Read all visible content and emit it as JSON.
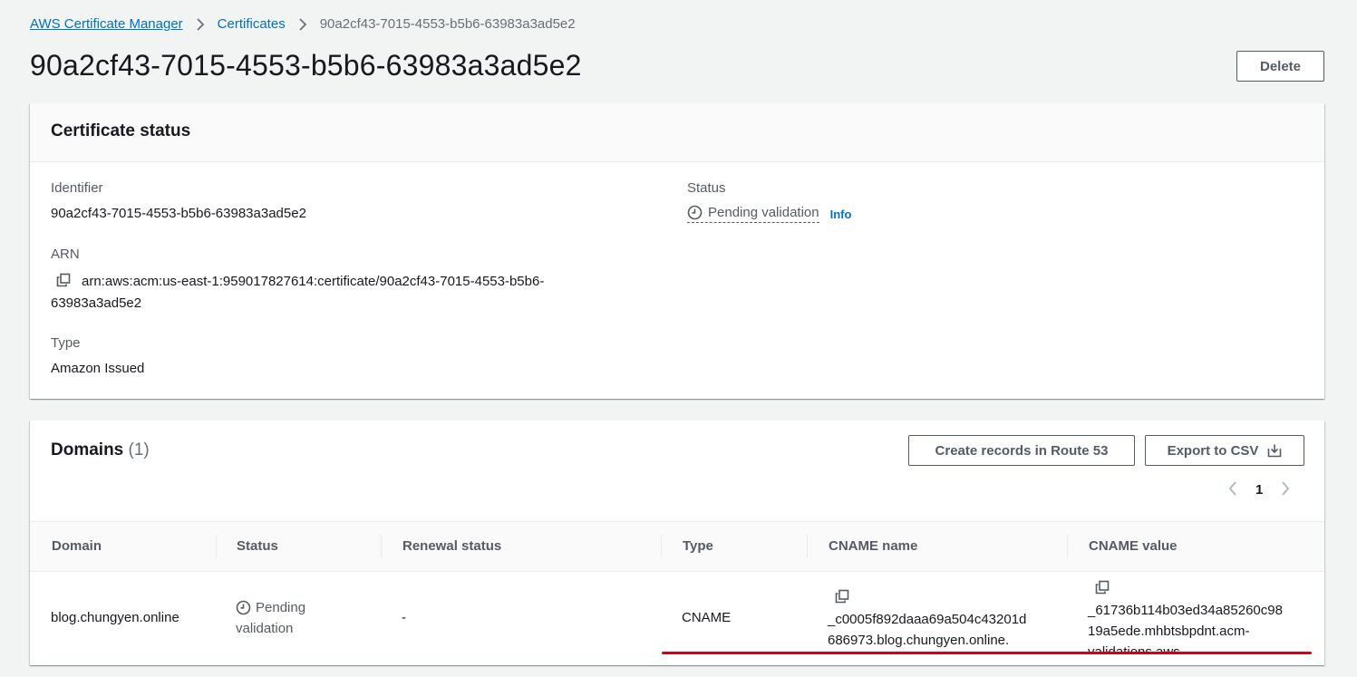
{
  "breadcrumb": {
    "root": "AWS Certificate Manager",
    "certificates": "Certificates",
    "current": "90a2cf43-7015-4553-b5b6-63983a3ad5e2"
  },
  "page_title": "90a2cf43-7015-4553-b5b6-63983a3ad5e2",
  "delete_label": "Delete",
  "certificate_status": {
    "title": "Certificate status",
    "identifier_label": "Identifier",
    "identifier_value": "90a2cf43-7015-4553-b5b6-63983a3ad5e2",
    "status_label": "Status",
    "status_value": "Pending validation",
    "info_label": "Info",
    "arn_label": "ARN",
    "arn_value": "arn:aws:acm:us-east-1:959017827614:certificate/90a2cf43-7015-4553-b5b6-63983a3ad5e2",
    "type_label": "Type",
    "type_value": "Amazon Issued"
  },
  "domains": {
    "title": "Domains",
    "count": "(1)",
    "create_records_label": "Create records in Route 53",
    "export_label": "Export to CSV",
    "page_number": "1",
    "columns": [
      "Domain",
      "Status",
      "Renewal status",
      "Type",
      "CNAME name",
      "CNAME value"
    ],
    "rows": [
      {
        "domain": "blog.chungyen.online",
        "status_line1": "Pending",
        "status_line2": "validation",
        "renewal_status": "-",
        "type": "CNAME",
        "cname_name_line1": "_c0005f892daaa69a504c43201d",
        "cname_name_line2": "686973.blog.chungyen.online.",
        "cname_value_line1": "_61736b114b03ed34a85260c98",
        "cname_value_line2": "19a5ede.mhbtsbpdnt.acm-",
        "cname_value_line3": "validations.aws."
      }
    ]
  },
  "colors": {
    "link": "#0073bb",
    "annotation": "#d0021b"
  }
}
